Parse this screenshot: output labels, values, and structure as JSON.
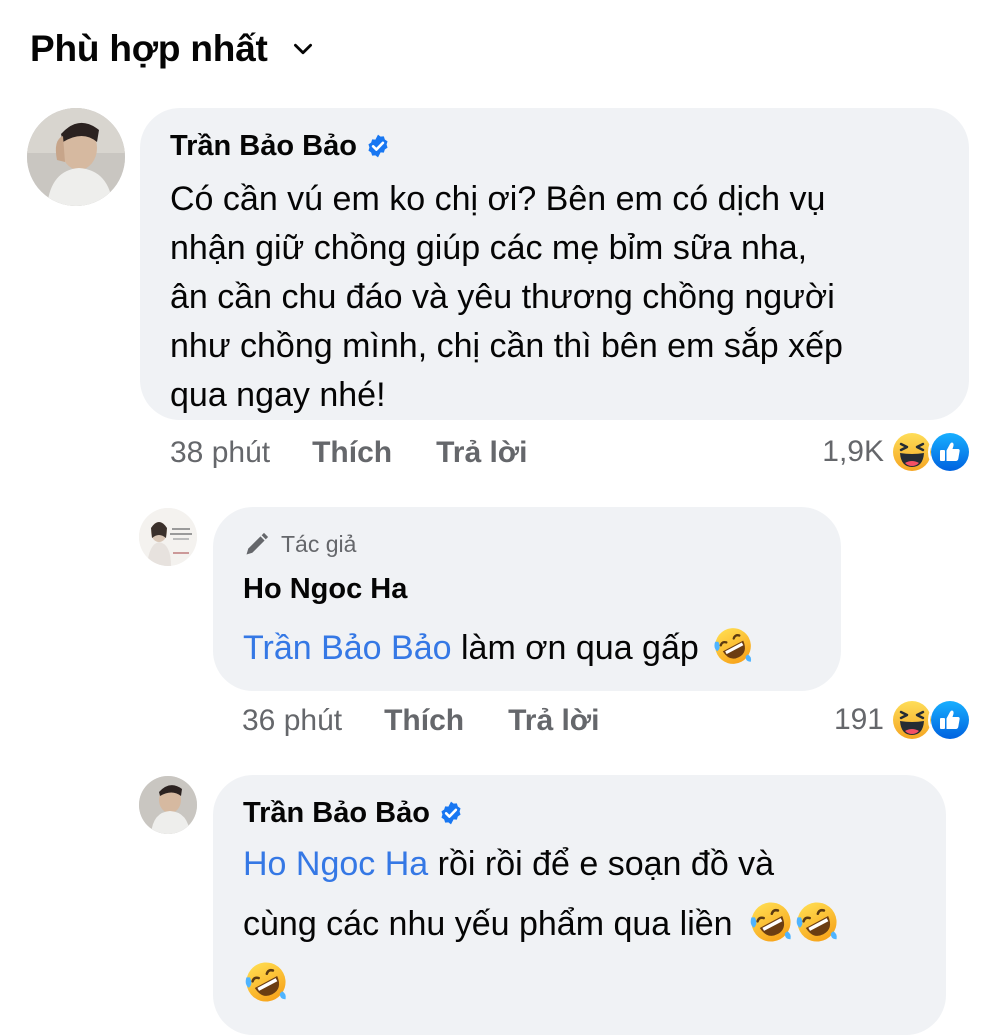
{
  "sort": {
    "label": "Phù hợp nhất",
    "icon": "chevron-down-icon"
  },
  "comments": [
    {
      "author": "Trần Bảo Bảo",
      "verified": true,
      "text": "Có cần vú em ko chị ơi? Bên em có dịch vụ nhận giữ chồng giúp các mẹ bỉm sữa nha, ân cần chu đáo và yêu thương chồng người như chồng mình, chị cần thì bên em sắp xếp qua ngay nhé!",
      "lines": [
        "Có cần vú em ko chị ơi? Bên em có dịch vụ",
        "nhận giữ chồng giúp các mẹ bỉm sữa nha,",
        "ân cần chu đáo và yêu thương chồng người",
        "như chồng mình, chị cần thì bên em sắp xếp",
        "qua ngay nhé!"
      ],
      "time": "38 phút",
      "like_label": "Thích",
      "reply_label": "Trả lời",
      "reaction_count": "1,9K",
      "reaction_icons": [
        "haha-icon",
        "like-icon"
      ]
    },
    {
      "author_tag": "Tác giả",
      "author_tag_icon": "pen-icon",
      "author": "Ho Ngoc Ha",
      "mention": "Trần Bảo Bảo",
      "text": "làm ơn qua gấp",
      "emoji": "rofl-emoji",
      "time": "36 phút",
      "like_label": "Thích",
      "reply_label": "Trả lời",
      "reaction_count": "191",
      "reaction_icons": [
        "haha-icon",
        "like-icon"
      ]
    },
    {
      "author": "Trần Bảo Bảo",
      "verified": true,
      "mention": "Ho Ngoc Ha",
      "line1_rest": "rồi rồi để e soạn đồ và",
      "line2": "cùng các nhu yếu phẩm qua liền",
      "emojis": [
        "rofl-emoji",
        "rofl-emoji",
        "rofl-emoji"
      ]
    }
  ],
  "colors": {
    "bubble": "#f0f2f5",
    "mention": "#3578e5",
    "secondary_text": "#65676b",
    "verified": "#1877f2",
    "like": "#1877f2",
    "haha": "#f7b928"
  }
}
